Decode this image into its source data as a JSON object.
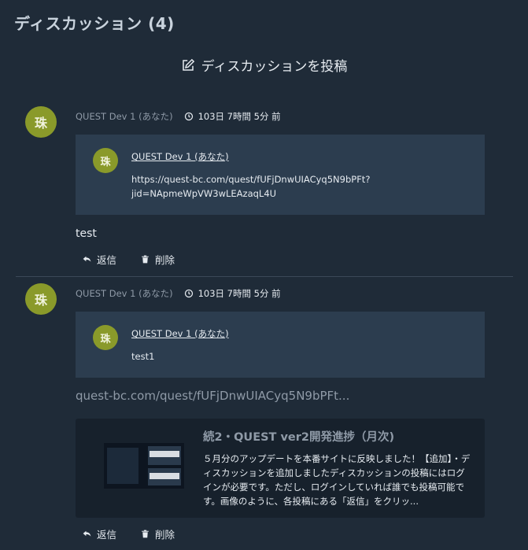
{
  "header": {
    "title": "ディスカッション (4)"
  },
  "post_button": {
    "label": "ディスカッションを投稿"
  },
  "posts": [
    {
      "author": "QUEST Dev 1 (あなた)",
      "time": "103日 7時間 5分 前",
      "quote": {
        "author": "QUEST Dev 1 (あなた)",
        "lines": [
          "https://quest-bc.com/quest/fUFjDnwUIACyq5N9bPFt?",
          "jid=NApmeWpVW3wLEAzaqL4U"
        ]
      },
      "body": "test",
      "reply_label": "返信",
      "delete_label": "削除"
    },
    {
      "author": "QUEST Dev 1 (あなた)",
      "time": "103日 7時間 5分 前",
      "quote": {
        "author": "QUEST Dev 1 (あなた)",
        "lines": [
          "test1"
        ]
      },
      "link_url": "quest-bc.com/quest/fUFjDnwUIACyq5N9bPFt...",
      "link_card": {
        "title": "続2・QUEST ver2開発進捗（月次)",
        "description": "５月分のアップデートを本番サイトに反映しました！【追加】・ディスカッションを追加しましたディスカッションの投稿にはログインが必要です。ただし、ログインしていれば誰でも投稿可能です。画像のように、各投稿にある「返信」をクリッ..."
      },
      "reply_label": "返信",
      "delete_label": "削除"
    }
  ],
  "avatar_text": "珠",
  "colors": {
    "background": "#1f2b38",
    "quote_bg": "#2c3d4f",
    "card_bg": "#17212c",
    "avatar": "#8a9a2a"
  }
}
